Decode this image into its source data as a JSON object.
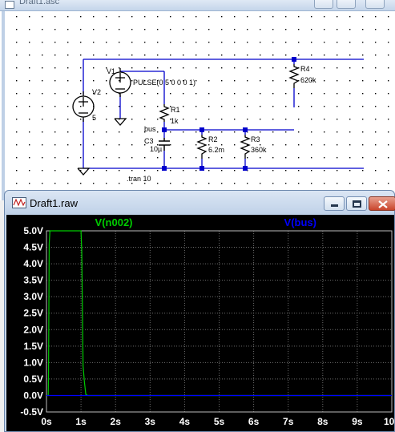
{
  "schematic_window": {
    "title": "Draft1.asc",
    "labels": {
      "v1": "V1",
      "v1_value": "PULSE(0 5 0 0 0 1)",
      "v2": "V2",
      "v2_value": "5",
      "r1": "R1",
      "r1_value": "1k",
      "r2": "R2",
      "r2_value": "6.2m",
      "r3": "R3",
      "r3_value": "360k",
      "r4": "R4",
      "r4_value": "620k",
      "c3": "C3",
      "c3_value": "10µ",
      "net_bus": "bus",
      "directive": ".tran 10"
    }
  },
  "plot_window": {
    "title": "Draft1.raw",
    "buttons": {
      "minimize": "minimize",
      "maximize": "maximize",
      "close": "close"
    }
  },
  "chart_data": {
    "type": "line",
    "background": "#000000",
    "grid": true,
    "x": {
      "label": "",
      "range": [
        0,
        10
      ],
      "ticks": [
        "0s",
        "1s",
        "2s",
        "3s",
        "4s",
        "5s",
        "6s",
        "7s",
        "8s",
        "9s",
        "10s"
      ]
    },
    "y": {
      "label": "",
      "range": [
        -0.5,
        5.0
      ],
      "ticks": [
        "5.0V",
        "4.5V",
        "4.0V",
        "3.5V",
        "3.0V",
        "2.5V",
        "2.0V",
        "1.5V",
        "1.0V",
        "0.5V",
        "0.0V",
        "-0.5V"
      ]
    },
    "series": [
      {
        "name": "V(n002)",
        "color": "#00cc00",
        "points": [
          [
            0.0,
            0.0
          ],
          [
            0.05,
            0.0
          ],
          [
            0.06,
            0.7
          ],
          [
            0.08,
            4.6
          ],
          [
            0.1,
            5.0
          ],
          [
            1.0,
            5.0
          ],
          [
            1.02,
            4.4
          ],
          [
            1.06,
            0.9
          ],
          [
            1.1,
            0.4
          ],
          [
            1.14,
            0.03
          ],
          [
            1.2,
            0.0
          ],
          [
            10.0,
            0.0
          ]
        ]
      },
      {
        "name": "V(bus)",
        "color": "#0000ff",
        "points": [
          [
            0.0,
            0.0
          ],
          [
            10.0,
            0.0
          ]
        ]
      }
    ]
  },
  "colors": {
    "wire": "#0000cc",
    "component": "#000000",
    "grid_dots": "#000000",
    "plot_grid": "#6e6e6e",
    "plot_text": "#ffffff"
  }
}
